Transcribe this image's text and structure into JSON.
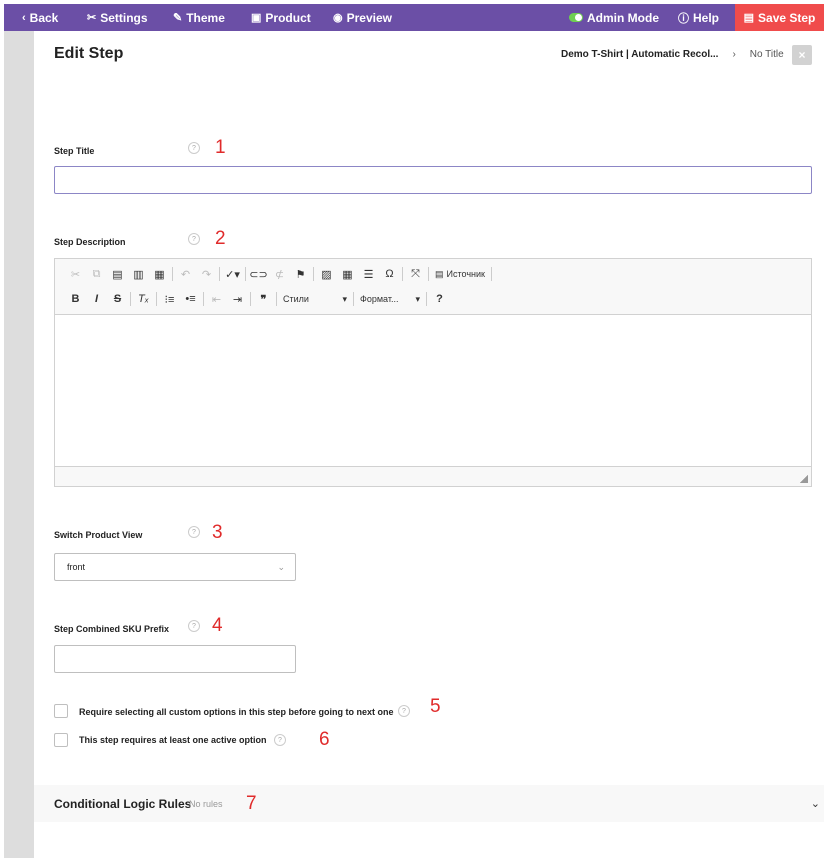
{
  "topbar": {
    "back": "Back",
    "settings": "Settings",
    "theme": "Theme",
    "product": "Product",
    "preview": "Preview",
    "admin_mode": "Admin Mode",
    "help": "Help",
    "save": "Save Step",
    "color": "#6b4fa6",
    "save_color": "#f04c4c"
  },
  "header": {
    "title": "Edit Step",
    "breadcrumb_product": "Demo T-Shirt | Automatic Recol...",
    "breadcrumb_sep": "›",
    "breadcrumb_current": "No Title",
    "close": "×"
  },
  "fields": {
    "step_title": {
      "label": "Step Title",
      "value": "",
      "number": "1"
    },
    "step_description": {
      "label": "Step Description",
      "number": "2"
    },
    "switch_view": {
      "label": "Switch Product View",
      "value": "front",
      "number": "3"
    },
    "sku_prefix": {
      "label": "Step Combined SKU Prefix",
      "value": "",
      "number": "4"
    }
  },
  "help_glyph": "?",
  "editor": {
    "source_label": "Источник",
    "styles_label": "Стили",
    "format_label": "Формат..."
  },
  "checkboxes": [
    {
      "label": "Require selecting all custom options in this step before going to next one",
      "checked": false,
      "number": "5"
    },
    {
      "label": "This step requires at least one active option",
      "checked": false,
      "number": "6"
    }
  ],
  "conditional": {
    "title": "Conditional Logic Rules",
    "subtitle": "No rules",
    "number": "7"
  },
  "icons": [
    "chevron-left-icon",
    "tools-icon",
    "brush-icon",
    "bag-icon",
    "eye-icon",
    "toggle-icon",
    "help-circle-icon",
    "save-icon",
    "chevron-down-icon"
  ]
}
